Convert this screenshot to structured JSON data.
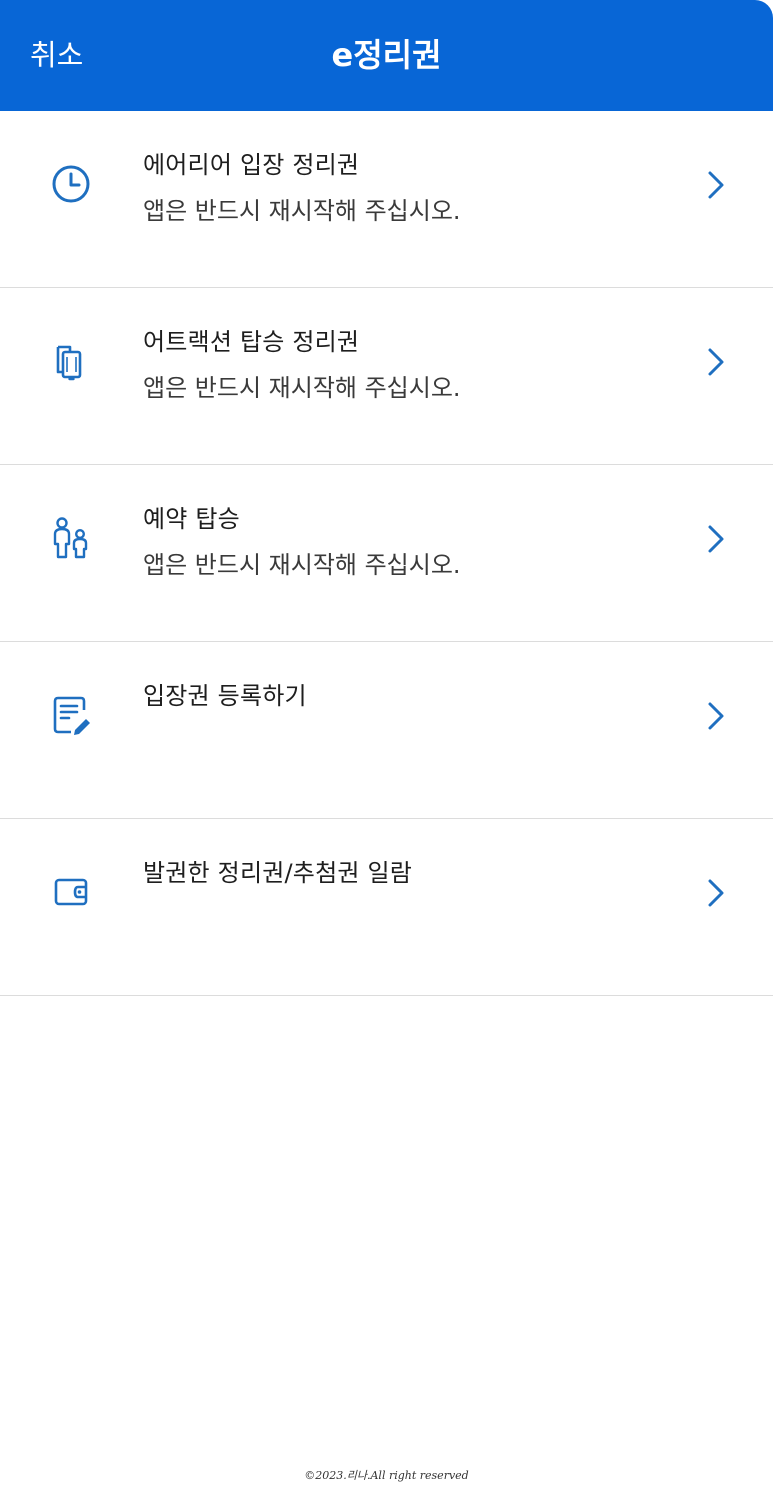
{
  "header": {
    "cancel_label": "취소",
    "title": "e정리권",
    "background_color": "#0866d6"
  },
  "menu": {
    "items": [
      {
        "icon": "clock-icon",
        "label": "에어리어 입장 정리권",
        "subtitle": "앱은 반드시 재시작해 주십시오."
      },
      {
        "icon": "tickets-icon",
        "label": "어트랙션 탑승 정리권",
        "subtitle": "앱은 반드시 재시작해 주십시오."
      },
      {
        "icon": "family-icon",
        "label": "예약 탑승",
        "subtitle": "앱은 반드시 재시작해 주십시오."
      },
      {
        "icon": "document-edit-icon",
        "label": "입장권 등록하기",
        "subtitle": ""
      },
      {
        "icon": "wallet-icon",
        "label": "발권한 정리권/추첨권 일람",
        "subtitle": ""
      }
    ],
    "icon_color": "#1f6fc0",
    "chevron_icon": "chevron-right-icon"
  },
  "footer": {
    "copyright": "©2023.리나.All  right reserved"
  }
}
